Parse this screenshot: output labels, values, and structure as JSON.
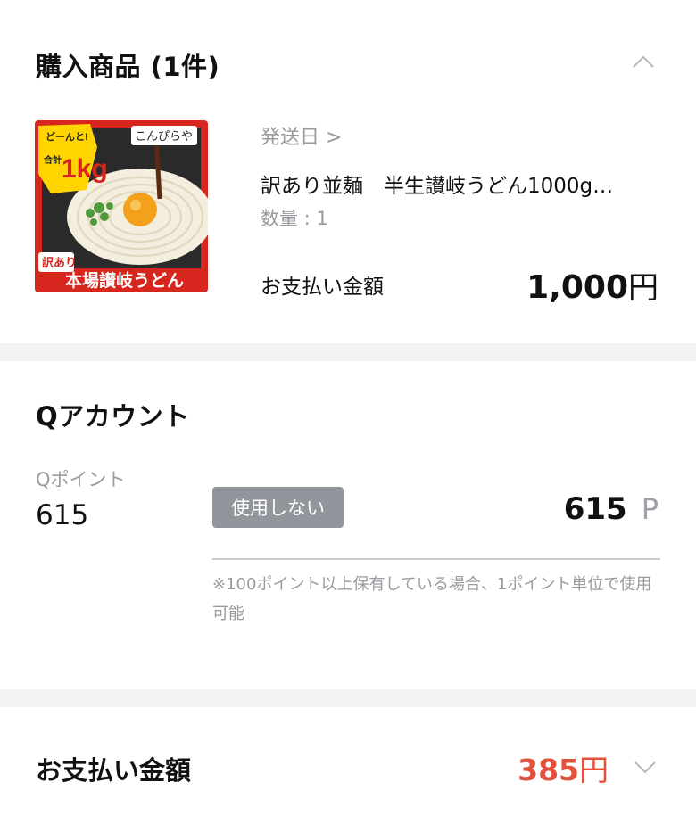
{
  "purchase": {
    "title": "購入商品 (1件)",
    "ship_date_label": "発送日 >",
    "product_name": "訳あり並麺　半生讃岐うどん1000g…",
    "quantity": "数量 : 1",
    "payment_label": "お支払い金額",
    "payment_amount": "1,000",
    "currency": "円",
    "image_text": {
      "badge_top": "どーんと!",
      "badge_main": "1kg",
      "badge_side": "合計",
      "brand": "こんぴらや",
      "tag": "訳あり",
      "caption": "本場讃岐うどん"
    }
  },
  "q_account": {
    "title": "Qアカウント",
    "points_label": "Qポイント",
    "points_balance": "615",
    "no_use_button": "使用しない",
    "points_used": "615",
    "points_unit": "P",
    "note": "※100ポイント以上保有している場合、1ポイント単位で使用可能"
  },
  "total": {
    "label": "お支払い金額",
    "amount": "385",
    "currency": "円"
  },
  "icons": {
    "collapse": "chevron-up-icon",
    "expand": "chevron-down-icon"
  },
  "colors": {
    "accent_red": "#e4503a",
    "button_gray": "#93959c",
    "muted_text": "#9a9aa0"
  }
}
